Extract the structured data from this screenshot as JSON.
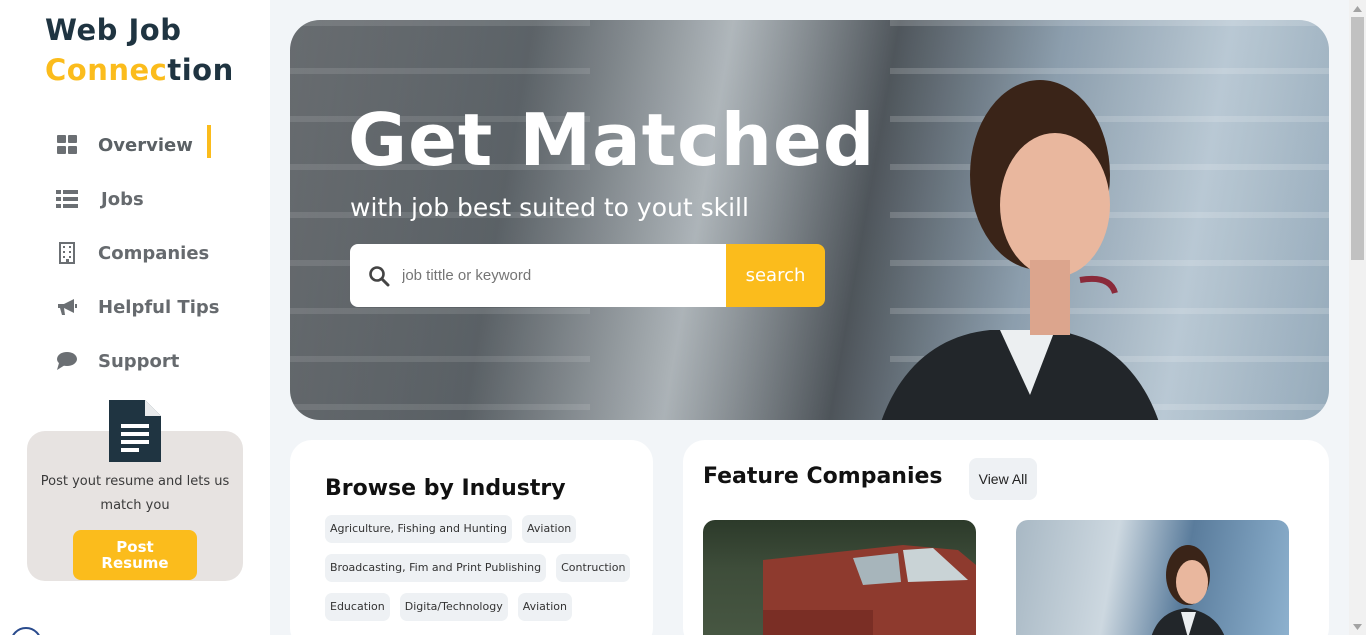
{
  "brand": {
    "line1": "Web Job",
    "line2_yellow": "Connec",
    "line2_dark": "tion"
  },
  "nav": {
    "items": [
      {
        "label": "Overview",
        "icon": "grid-icon",
        "active": true
      },
      {
        "label": "Jobs",
        "icon": "list-icon",
        "active": false
      },
      {
        "label": "Companies",
        "icon": "building-icon",
        "active": false
      },
      {
        "label": "Helpful Tips",
        "icon": "megaphone-icon",
        "active": false
      },
      {
        "label": "Support",
        "icon": "chat-bubble-icon",
        "active": false
      }
    ]
  },
  "resume": {
    "text": "Post yout resume and lets us match you",
    "button_line1": "Post",
    "button_line2": "Resume"
  },
  "hero": {
    "title": "Get Matched",
    "subtitle": "with job best suited to yout skill",
    "search_placeholder": "job tittle or keyword",
    "search_button": "search"
  },
  "industry": {
    "heading": "Browse by Industry",
    "rows": [
      [
        "Agriculture, Fishing and Hunting",
        "Aviation"
      ],
      [
        "Broadcasting, Fim and Print Publishing",
        "Contruction"
      ],
      [
        "Education",
        "Digita/Technology",
        "Aviation"
      ]
    ]
  },
  "feature": {
    "heading": "Feature Companies",
    "view_all": "View All"
  },
  "colors": {
    "accent": "#fbbc1c",
    "brand_dark": "#1f3441",
    "nav_text": "#666a6e"
  }
}
